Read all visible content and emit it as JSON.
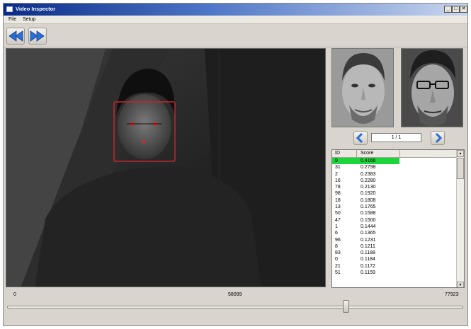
{
  "window": {
    "title": "Video Inspector",
    "min": "_",
    "max": "□",
    "close": "✕"
  },
  "menu": {
    "file": "File",
    "setup": "Setup"
  },
  "toolbar": {
    "rewind_icon": "rewind-icon",
    "forward_icon": "fast-forward-icon"
  },
  "pager": {
    "value": "1 / 1",
    "prev_icon": "chevron-left-icon",
    "next_icon": "chevron-right-icon"
  },
  "table": {
    "headers": {
      "id": "ID",
      "score": "Score"
    },
    "rows": [
      {
        "id": "9",
        "score": "0.4166",
        "selected": true
      },
      {
        "id": "31",
        "score": "0.2798"
      },
      {
        "id": "2",
        "score": "0.2383"
      },
      {
        "id": "16",
        "score": "0.2280"
      },
      {
        "id": "78",
        "score": "0.2130"
      },
      {
        "id": "98",
        "score": "0.1920"
      },
      {
        "id": "18",
        "score": "0.1808"
      },
      {
        "id": "13",
        "score": "0.1765"
      },
      {
        "id": "50",
        "score": "0.1588"
      },
      {
        "id": "47",
        "score": "0.1500"
      },
      {
        "id": "1",
        "score": "0.1444"
      },
      {
        "id": "6",
        "score": "0.1365"
      },
      {
        "id": "96",
        "score": "0.1231"
      },
      {
        "id": "8",
        "score": "0.1211"
      },
      {
        "id": "83",
        "score": "0.1188"
      },
      {
        "id": "0",
        "score": "0.1184"
      },
      {
        "id": "21",
        "score": "0.1172"
      },
      {
        "id": "51",
        "score": "0.1159"
      }
    ]
  },
  "timeline": {
    "start": "0",
    "current": "58099",
    "end": "77923",
    "position_fraction": 0.746
  },
  "colors": {
    "selected_row": "#1bd53b",
    "face_box": "#c0282c",
    "title_gradient_start": "#0a2c88",
    "nav_arrow": "#2a6fd6"
  }
}
